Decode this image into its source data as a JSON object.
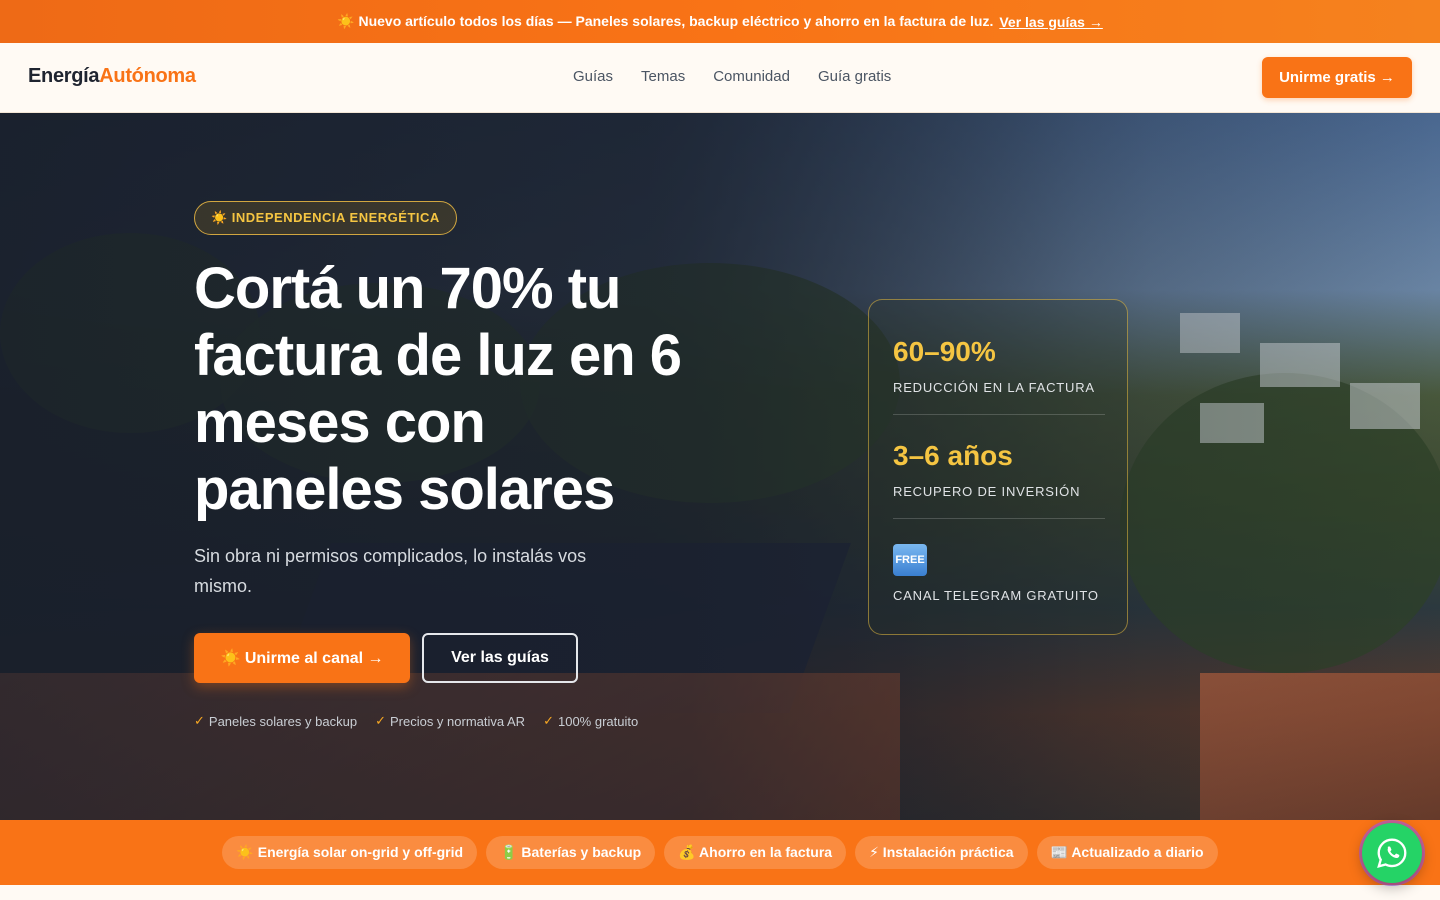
{
  "announcement": {
    "icon": "sun-icon",
    "text": "☀️ Nuevo artículo todos los días — Paneles solares, backup eléctrico y ahorro en la factura de luz.",
    "link": "Ver las guías →"
  },
  "header": {
    "logo_part1": "Energía",
    "logo_part2": "Autónoma",
    "nav": [
      "Guías",
      "Temas",
      "Comunidad",
      "Guía gratis"
    ],
    "cta": "Unirme gratis →"
  },
  "hero": {
    "badge": "☀️ INDEPENDENCIA ENERGÉTICA",
    "headline": "Cortá un 70% tu factura de luz en 6 meses con paneles solares",
    "sub": "Sin obra ni permisos complicados, lo instalás vos mismo.",
    "primary_cta": "☀️ Unirme al canal →",
    "secondary_cta": "Ver las guías",
    "checks": [
      "Paneles solares y backup",
      "Precios y normativa AR",
      "100% gratuito"
    ]
  },
  "stats": [
    {
      "value": "60–90%",
      "label": "Reducción en la factura"
    },
    {
      "value": "3–6 años",
      "label": "Recupero de inversión"
    },
    {
      "value": "FREE",
      "label": "Canal Telegram gratuito"
    }
  ],
  "features": [
    "☀️ Energía solar on-grid y off-grid",
    "🔋 Baterías y backup",
    "💰 Ahorro en la factura",
    "⚡ Instalación práctica",
    "📰 Actualizado a diario"
  ],
  "colors": {
    "accent": "#f97316",
    "gold": "#f5c542",
    "whatsapp": "#25d366"
  }
}
